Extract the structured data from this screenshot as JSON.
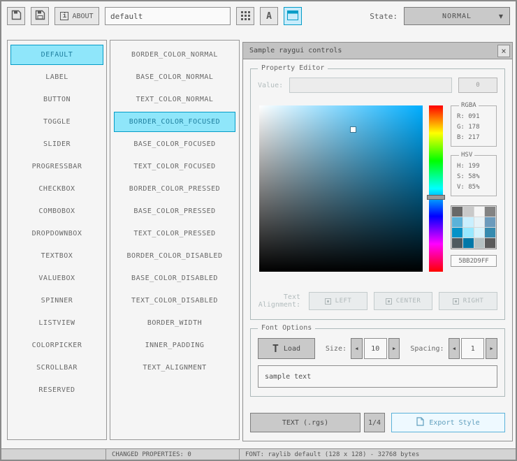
{
  "colors": {
    "accent": "#5bb2d9",
    "selected_bg": "#8fe6fa",
    "selected_border": "#049cc7",
    "picker_hue_color": "#00aeff"
  },
  "icons": {
    "chevron_down": "▼",
    "chevron_left": "◀",
    "chevron_right": "▶",
    "close": "×",
    "info": "i",
    "font_letter": "A",
    "load_font_glyph": "T"
  },
  "toolbar": {
    "about_label": "ABOUT",
    "style_name_value": "default",
    "state_label": "State:",
    "state_value": "NORMAL"
  },
  "controls_list": {
    "selected": "DEFAULT",
    "items": [
      "DEFAULT",
      "LABEL",
      "BUTTON",
      "TOGGLE",
      "SLIDER",
      "PROGRESSBAR",
      "CHECKBOX",
      "COMBOBOX",
      "DROPDOWNBOX",
      "TEXTBOX",
      "VALUEBOX",
      "SPINNER",
      "LISTVIEW",
      "COLORPICKER",
      "SCROLLBAR",
      "RESERVED"
    ]
  },
  "properties_list": {
    "selected": "BORDER_COLOR_FOCUSED",
    "items": [
      "BORDER_COLOR_NORMAL",
      "BASE_COLOR_NORMAL",
      "TEXT_COLOR_NORMAL",
      "BORDER_COLOR_FOCUSED",
      "BASE_COLOR_FOCUSED",
      "TEXT_COLOR_FOCUSED",
      "BORDER_COLOR_PRESSED",
      "BASE_COLOR_PRESSED",
      "TEXT_COLOR_PRESSED",
      "BORDER_COLOR_DISABLED",
      "BASE_COLOR_DISABLED",
      "TEXT_COLOR_DISABLED",
      "BORDER_WIDTH",
      "INNER_PADDING",
      "TEXT_ALIGNMENT"
    ]
  },
  "sample_window": {
    "title": "Sample raygui controls"
  },
  "property_editor": {
    "group_label": "Property Editor",
    "value_label": "Value:",
    "value_input": "",
    "value_button": "0",
    "rgba": {
      "label": "RGBA",
      "r": "R: 091",
      "g": "G: 178",
      "b": "B: 217"
    },
    "hsv": {
      "label": "HSV",
      "h": "H: 199",
      "s": "S: 58%",
      "v": "V: 85%"
    },
    "hex_value": "5BB2D9FF",
    "swatches": [
      "#686868",
      "#c9c9c9",
      "#f5f5f5",
      "#838383",
      "#5bb2d9",
      "#c9effe",
      "#e6f2f7",
      "#6c9bbc",
      "#0492c7",
      "#97e8ff",
      "#d5f3fc",
      "#368baf",
      "#4f5a5f",
      "#0078a8",
      "#b5c1c2",
      "#5b5b5b"
    ],
    "text_alignment_label": "Text Alignment:",
    "align_left": "LEFT",
    "align_center": "CENTER",
    "align_right": "RIGHT"
  },
  "font_options": {
    "group_label": "Font Options",
    "load_button": "Load",
    "size_label": "Size:",
    "size_value": "10",
    "spacing_label": "Spacing:",
    "spacing_value": "1",
    "sample_text": "sample text"
  },
  "export": {
    "format_button": "TEXT (.rgs)",
    "page_button": "1/4",
    "export_button": "Export Style"
  },
  "statusbar": {
    "changed": "CHANGED PROPERTIES: 0",
    "font_info": "FONT: raylib default (128 x 128) - 32768 bytes"
  }
}
